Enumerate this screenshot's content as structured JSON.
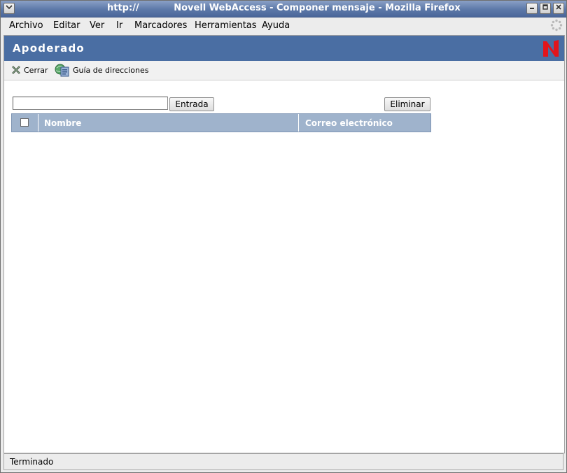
{
  "window": {
    "url": "http://",
    "title": "Novell WebAccess - Componer mensaje - Mozilla Firefox"
  },
  "menubar": {
    "items": [
      {
        "label": "Archivo"
      },
      {
        "label": "Editar"
      },
      {
        "label": "Ver"
      },
      {
        "label": "Ir"
      },
      {
        "label": "Marcadores"
      },
      {
        "label": "Herramientas"
      },
      {
        "label": "Ayuda"
      }
    ]
  },
  "page": {
    "banner_title": "Apoderado",
    "logo_icon": "novell-n-logo",
    "brand_color": "#4a6ea3",
    "logo_color": "#e3141b"
  },
  "toolbar": {
    "close_label": "Cerrar",
    "close_icon": "close-x-icon",
    "address_book_label": "Guía de direcciones",
    "address_book_icon": "address-book-icon"
  },
  "form": {
    "entry_value": "",
    "entry_button": "Entrada",
    "delete_button": "Eliminar"
  },
  "table": {
    "columns": [
      "Nombre",
      "Correo electrónico"
    ],
    "header_color": "#9fb3cc",
    "rows": []
  },
  "status": {
    "text": "Terminado"
  }
}
